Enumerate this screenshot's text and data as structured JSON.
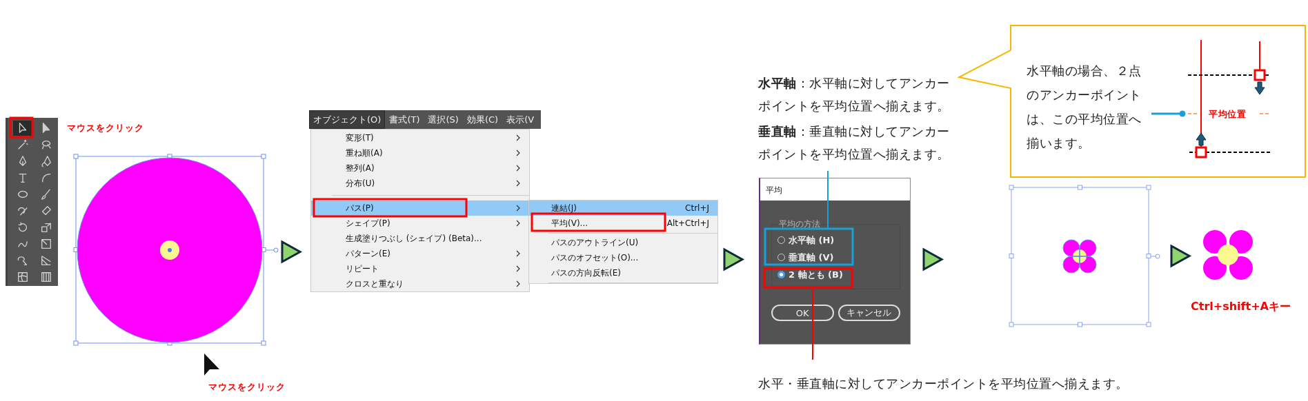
{
  "annotations": {
    "click_tool": "マウスをクリック",
    "click_canvas": "マウスをクリック",
    "shortcut": "Ctrl+shift+Aキー",
    "caption": "水平・垂直軸に対してアンカーポイントを平均位置へ揃えます。"
  },
  "toolbar": {
    "tools": [
      {
        "selected": true
      },
      {
        "selected": false
      },
      {
        "selected": false
      },
      {
        "selected": false
      },
      {
        "selected": false
      },
      {
        "selected": false
      },
      {
        "selected": false
      },
      {
        "selected": false
      },
      {
        "selected": false
      },
      {
        "selected": false
      },
      {
        "selected": false
      },
      {
        "selected": false
      },
      {
        "selected": false
      },
      {
        "selected": false
      },
      {
        "selected": false
      },
      {
        "selected": false
      },
      {
        "selected": false
      },
      {
        "selected": false
      },
      {
        "selected": false
      },
      {
        "selected": false
      }
    ]
  },
  "menubar": [
    {
      "label": "オブジェクト(O)",
      "selected": true
    },
    {
      "label": "書式(T)",
      "selected": false
    },
    {
      "label": "選択(S)",
      "selected": false
    },
    {
      "label": "効果(C)",
      "selected": false
    },
    {
      "label": "表示(V",
      "selected": false
    }
  ],
  "menu": {
    "groups": [
      [
        {
          "label": "変形(T)",
          "submenu": true,
          "selected": false
        },
        {
          "label": "重ね順(A)",
          "submenu": true,
          "selected": false
        },
        {
          "label": "整列(A)",
          "submenu": true,
          "selected": false
        },
        {
          "label": "分布(U)",
          "submenu": true,
          "selected": false
        }
      ],
      [
        {
          "label": "パス(P)",
          "submenu": true,
          "selected": true
        },
        {
          "label": "シェイプ(P)",
          "submenu": true,
          "selected": false
        },
        {
          "label": "生成塗りつぶし (シェイプ) (Beta)...",
          "submenu": false,
          "selected": false
        },
        {
          "label": "パターン(E)",
          "submenu": true,
          "selected": false
        },
        {
          "label": "リピート",
          "submenu": true,
          "selected": false
        },
        {
          "label": "クロスと重なり",
          "submenu": true,
          "selected": false
        }
      ]
    ]
  },
  "submenu": {
    "groups": [
      [
        {
          "label": "連結(J)",
          "shortcut": "Ctrl+J",
          "selected": true
        },
        {
          "label": "平均(V)...",
          "shortcut": "Alt+Ctrl+J",
          "selected": false
        }
      ],
      [
        {
          "label": "パスのアウトライン(U)",
          "selected": false
        },
        {
          "label": "パスのオフセット(O)...",
          "selected": false
        },
        {
          "label": "パスの方向反転(E)",
          "selected": false
        }
      ]
    ]
  },
  "notes": [
    {
      "term": "水平軸",
      "text": "：水平軸に対してアンカーポイントを平均位置へ揃えます。"
    },
    {
      "term": "垂直軸",
      "text": "：垂直軸に対してアンカーポイントを平均位置へ揃えます。"
    }
  ],
  "dialog": {
    "title": "平均",
    "group_label": "平均の方法",
    "options": [
      {
        "label": "水平軸 (H)",
        "selected": false
      },
      {
        "label": "垂直軸 (V)",
        "selected": false
      },
      {
        "label": "2 軸とも (B)",
        "selected": true
      }
    ],
    "buttons": [
      "OK",
      "キャンセル"
    ]
  },
  "callout": {
    "text": "水平軸の場合、２点のアンカーポイントは、この平均位置へ揃います。",
    "diagram_label": "平均位置"
  }
}
